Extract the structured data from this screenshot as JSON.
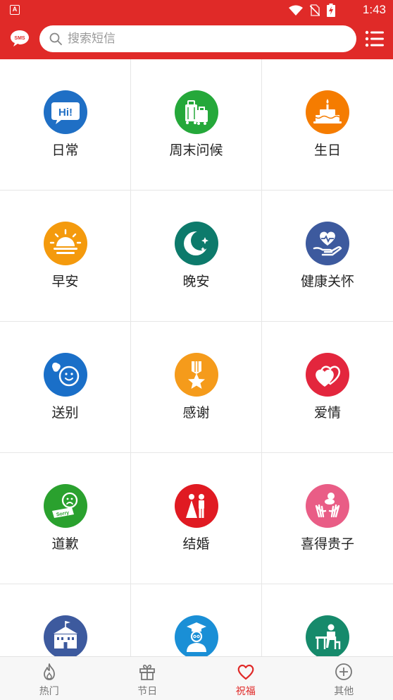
{
  "status_bar": {
    "app_badge": "A",
    "time": "1:43",
    "icons": [
      "wifi-icon",
      "no-sim-icon",
      "battery-charging-icon"
    ]
  },
  "header": {
    "logo_text": "SMS",
    "search_placeholder": "搜索短信",
    "menu_icon": "list-menu-icon"
  },
  "colors": {
    "brand": "#e02a28",
    "nav_active": "#e02a28",
    "nav_inactive": "#777777"
  },
  "categories": [
    {
      "label": "日常",
      "icon": "hi-speech-bubble-icon",
      "color": "#1f6fc5"
    },
    {
      "label": "周末问候",
      "icon": "luggage-icon",
      "color": "#25a83a"
    },
    {
      "label": "生日",
      "icon": "birthday-cake-icon",
      "color": "#f57c00"
    },
    {
      "label": "早安",
      "icon": "sunrise-icon",
      "color": "#f49a0d"
    },
    {
      "label": "晚安",
      "icon": "moon-stars-icon",
      "color": "#0d7a6b"
    },
    {
      "label": "健康关怀",
      "icon": "heart-hand-icon",
      "color": "#3d5a9e"
    },
    {
      "label": "送别",
      "icon": "waving-smiley-icon",
      "color": "#1a6fc8"
    },
    {
      "label": "感谢",
      "icon": "medal-star-icon",
      "color": "#f59b1b"
    },
    {
      "label": "爱情",
      "icon": "double-heart-icon",
      "color": "#e3263d"
    },
    {
      "label": "道歉",
      "icon": "sorry-face-icon",
      "color": "#2aa12e"
    },
    {
      "label": "结婚",
      "icon": "wedding-couple-icon",
      "color": "#e01a22"
    },
    {
      "label": "喜得贵子",
      "icon": "baby-hands-icon",
      "color": "#e95d86"
    },
    {
      "label": "",
      "icon": "school-building-icon",
      "color": "#3d5a9e"
    },
    {
      "label": "",
      "icon": "graduate-icon",
      "color": "#1a8fd6"
    },
    {
      "label": "",
      "icon": "desk-reading-icon",
      "color": "#168a6b"
    }
  ],
  "bottom_nav": [
    {
      "label": "热门",
      "icon": "flame-icon",
      "active": false
    },
    {
      "label": "节日",
      "icon": "gift-icon",
      "active": false
    },
    {
      "label": "祝福",
      "icon": "heart-outline-icon",
      "active": true
    },
    {
      "label": "其他",
      "icon": "plus-circle-icon",
      "active": false
    }
  ]
}
